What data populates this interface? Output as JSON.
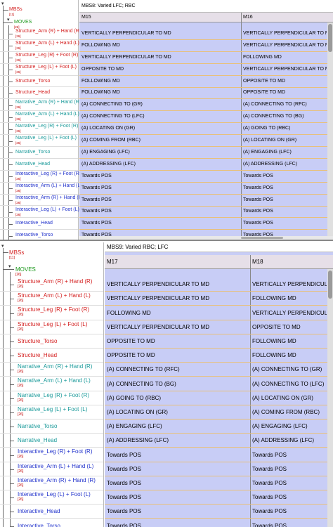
{
  "colors": {
    "red_tier": "#d42020",
    "green_tier": "#1f9a1f",
    "teal_tier": "#1a9a9a",
    "blue_tier": "#2233cc",
    "grid_bg": "#c8cdf6",
    "count": "#c00000"
  },
  "panel1": {
    "block_title": "MBS8: Varied LFC; RBC",
    "segments": [
      "M15",
      "M16"
    ],
    "root": {
      "label": "MBSs",
      "count": "[11]"
    },
    "moves": {
      "label": "MOVES",
      "count": "[26]"
    },
    "tiers": [
      {
        "label": "Structure_Arm (R) + Hand (R)",
        "count": "[26]",
        "color": "red",
        "cells": [
          "VERTICALLY PERPENDICULAR TO MD",
          "VERTICALLY PERPENDICULAR TO MD"
        ]
      },
      {
        "label": "Structure_Arm (L) + Hand (L)",
        "count": "[26]",
        "color": "red",
        "cells": [
          "FOLLOWING MD",
          "VERTICALLY PERPENDICULAR TO MD"
        ]
      },
      {
        "label": "Structure_Leg (R) + Foot (R)",
        "count": "[26]",
        "color": "red",
        "cells": [
          "VERTICALLY PERPENDICULAR TO MD",
          "FOLLOWING MD"
        ]
      },
      {
        "label": "Structure_Leg (L) + Foot (L)",
        "count": "[26]",
        "color": "red",
        "cells": [
          "OPPOSITE TO MD",
          "VERTICALLY PERPENDICULAR TO MD"
        ]
      },
      {
        "label": "Structure_Torso",
        "count": "",
        "color": "red",
        "cells": [
          "FOLLOWING MD",
          "OPPOSITE TO MD"
        ]
      },
      {
        "label": "Structure_Head",
        "count": "",
        "color": "red",
        "cells": [
          "FOLLOWING MD",
          "OPPOSITE TO MD"
        ]
      },
      {
        "label": "Narrative_Arm (R) + Hand (R)",
        "count": "[26]",
        "color": "teal",
        "cells": [
          "(A) CONNECTING TO (GR)",
          "(A) CONNECTING TO (RFC)"
        ]
      },
      {
        "label": "Narrative_Arm (L) + Hand (L)",
        "count": "[26]",
        "color": "teal",
        "cells": [
          "(A) CONNECTING TO (LFC)",
          "(A) CONNECTING TO (BG)"
        ]
      },
      {
        "label": "Narrative_Leg (R) + Foot (R)",
        "count": "[26]",
        "color": "teal",
        "cells": [
          "(A) LOCATING ON (GR)",
          "(A) GOING TO (RBC)"
        ]
      },
      {
        "label": "Narrative_Leg (L) + Foot (L)",
        "count": "[26]",
        "color": "teal",
        "cells": [
          "(A) COMING FROM (RBC)",
          "(A) LOCATING ON (GR)"
        ]
      },
      {
        "label": "Narrative_Torso",
        "count": "",
        "color": "teal",
        "cells": [
          "(A) ENGAGING (LFC)",
          "(A) ENGAGING (LFC)"
        ]
      },
      {
        "label": "Narrative_Head",
        "count": "",
        "color": "teal",
        "cells": [
          "(A) ADDRESSING (LFC)",
          "(A) ADDRESSING (LFC)"
        ]
      },
      {
        "label": "Interactive_Leg (R) + Foot (R)",
        "count": "[26]",
        "color": "blue",
        "cells": [
          "Towards POS",
          "Towards POS"
        ]
      },
      {
        "label": "Interactive_Arm (L) + Hand (L)",
        "count": "[26]",
        "color": "blue",
        "cells": [
          "Towards POS",
          "Towards POS"
        ]
      },
      {
        "label": "Interactive_Arm (R) + Hand (R)",
        "count": "[26]",
        "color": "blue",
        "cells": [
          "Towards POS",
          "Towards POS"
        ]
      },
      {
        "label": "Interactive_Leg (L) + Foot (L)",
        "count": "[26]",
        "color": "blue",
        "cells": [
          "Towards POS",
          "Towards POS"
        ]
      },
      {
        "label": "Interactive_Head",
        "count": "",
        "color": "blue",
        "cells": [
          "Towards POS",
          "Towards POS"
        ]
      },
      {
        "label": "Interactive_Torso",
        "count": "",
        "color": "blue",
        "cells": [
          "Towards POS",
          "Towards POS"
        ]
      }
    ]
  },
  "panel2": {
    "block_title": "MBS9: Varied RBC; LFC",
    "segments": [
      "M17",
      "M18"
    ],
    "root": {
      "label": "MBSs",
      "count": "[11]"
    },
    "moves": {
      "label": "MOVES",
      "count": "[26]"
    },
    "tiers": [
      {
        "label": "Structure_Arm (R) + Hand (R)",
        "count": "[26]",
        "color": "red",
        "cells": [
          "VERTICALLY PERPENDICULAR TO MD",
          "VERTICALLY PERPENDICULAR TO MD"
        ]
      },
      {
        "label": "Structure_Arm (L) + Hand (L)",
        "count": "[26]",
        "color": "red",
        "cells": [
          "VERTICALLY PERPENDICULAR TO MD",
          "FOLLOWING MD"
        ]
      },
      {
        "label": "Structure_Leg (R) + Foot (R)",
        "count": "[26]",
        "color": "red",
        "cells": [
          "FOLLOWING MD",
          "VERTICALLY PERPENDICULAR TO MD"
        ]
      },
      {
        "label": "Structure_Leg (L) + Foot (L)",
        "count": "[26]",
        "color": "red",
        "cells": [
          "VERTICALLY PERPENDICULAR TO MD",
          "OPPOSITE TO MD"
        ]
      },
      {
        "label": "Structure_Torso",
        "count": "",
        "color": "red",
        "cells": [
          "OPPOSITE TO MD",
          "FOLLOWING MD"
        ]
      },
      {
        "label": "Structure_Head",
        "count": "",
        "color": "red",
        "cells": [
          "OPPOSITE TO MD",
          "FOLLOWING MD"
        ]
      },
      {
        "label": "Narrative_Arm (R) + Hand (R)",
        "count": "[26]",
        "color": "teal",
        "cells": [
          "(A) CONNECTING TO (RFC)",
          "(A) CONNECTING TO (GR)"
        ]
      },
      {
        "label": "Narrative_Arm (L) + Hand (L)",
        "count": "[26]",
        "color": "teal",
        "cells": [
          "(A) CONNECTING TO (BG)",
          "(A) CONNECTING TO (LFC)"
        ]
      },
      {
        "label": "Narrative_Leg (R) + Foot (R)",
        "count": "[26]",
        "color": "teal",
        "cells": [
          "(A) GOING TO (RBC)",
          "(A) LOCATING ON (GR)"
        ]
      },
      {
        "label": "Narrative_Leg (L) + Foot (L)",
        "count": "[26]",
        "color": "teal",
        "cells": [
          "(A) LOCATING ON (GR)",
          "(A) COMING FROM (RBC)"
        ]
      },
      {
        "label": "Narrative_Torso",
        "count": "",
        "color": "teal",
        "cells": [
          "(A) ENGAGING (LFC)",
          "(A) ENGAGING (LFC)"
        ]
      },
      {
        "label": "Narrative_Head",
        "count": "",
        "color": "teal",
        "cells": [
          "(A) ADDRESSING (LFC)",
          "(A) ADDRESSING (LFC)"
        ]
      },
      {
        "label": "Interactive_Leg (R) + Foot (R)",
        "count": "[26]",
        "color": "blue",
        "cells": [
          "Towards POS",
          "Towards POS"
        ]
      },
      {
        "label": "Interactive_Arm (L) + Hand (L)",
        "count": "[26]",
        "color": "blue",
        "cells": [
          "Towards POS",
          "Towards POS"
        ]
      },
      {
        "label": "Interactive_Arm (R) + Hand (R)",
        "count": "[26]",
        "color": "blue",
        "cells": [
          "Towards POS",
          "Towards POS"
        ]
      },
      {
        "label": "Interactive_Leg (L) + Foot (L)",
        "count": "[26]",
        "color": "blue",
        "cells": [
          "Towards POS",
          "Towards POS"
        ]
      },
      {
        "label": "Interactive_Head",
        "count": "",
        "color": "blue",
        "cells": [
          "Towards POS",
          "Towards POS"
        ]
      },
      {
        "label": "Interactive_Torso",
        "count": "",
        "color": "blue",
        "cells": [
          "Towards POS",
          "Towards POS"
        ]
      }
    ]
  }
}
